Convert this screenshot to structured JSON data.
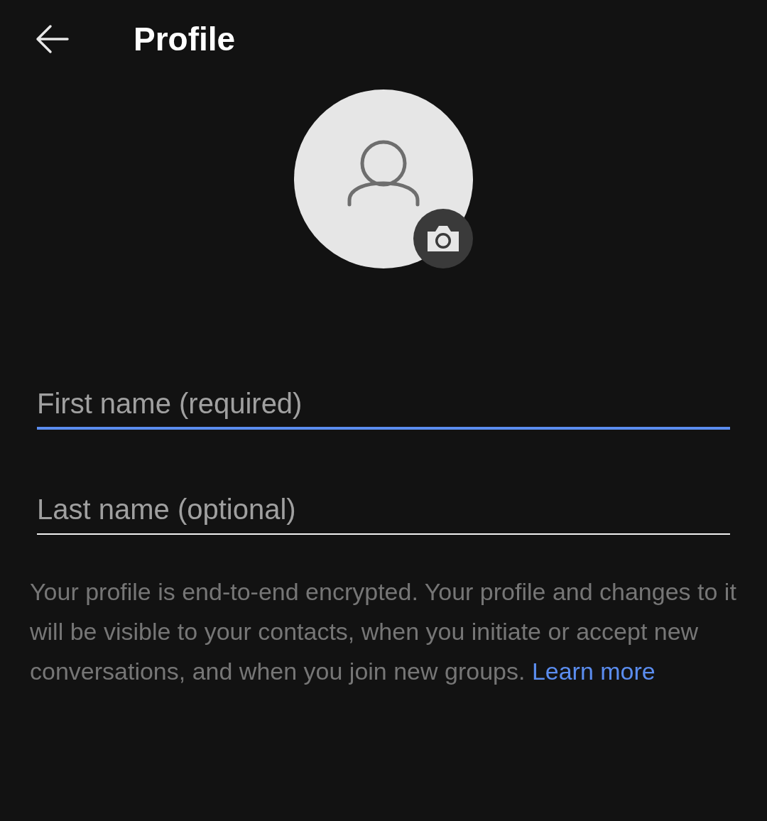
{
  "header": {
    "title": "Profile"
  },
  "fields": [
    {
      "placeholder": "First name (required)",
      "focused": true
    },
    {
      "placeholder": "Last name (optional)",
      "focused": false
    }
  ],
  "notice": {
    "text": "Your profile is end-to-end encrypted. Your profile and changes to it will be visible to your contacts, when you initiate or accept new conversations, and when you join new groups.",
    "link": "Learn more"
  }
}
